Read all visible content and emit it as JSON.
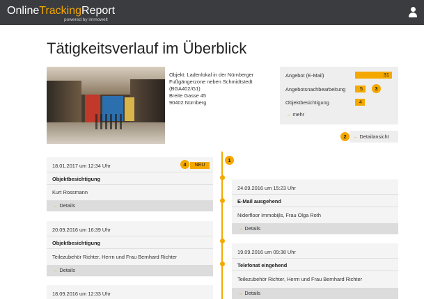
{
  "header": {
    "logo_pre": "Online",
    "logo_accent": "Tracking",
    "logo_post": "Report",
    "logo_sub": "powered by immowelt",
    "user_icon": "user-icon"
  },
  "page": {
    "title": "Tätigkeitsverlauf im Überblick"
  },
  "property": {
    "lines": [
      "Objekt: Ladenlokal in der Nürnberger",
      "Fußgängerzone neben Schmidtstedt",
      "(BGA402/G1)",
      "Breite Gasse 45",
      "90402 Nürnberg"
    ]
  },
  "stats": {
    "items": [
      {
        "label": "Angebot (E-Mail)",
        "value": "31"
      },
      {
        "label": "Angebotsnachbearbeitung",
        "value": "5"
      },
      {
        "label": "Objektbesichtigung",
        "value": "4"
      }
    ],
    "more_label": "mehr",
    "accent_color": "#f5a800"
  },
  "badges": {
    "b1": "1",
    "b2": "2",
    "b3": "3",
    "b4": "4"
  },
  "detail_button": "Detailansicht",
  "timeline": {
    "left": [
      {
        "date": "18.01.2017 um 12:34 Uhr",
        "title": "Objektbesichtigung",
        "person": "Kurt Rossmann",
        "details": "Details",
        "tag": "NEU"
      },
      {
        "date": "20.09.2016 um 16:39 Uhr",
        "title": "Objektbesichtigung",
        "person": "Teilezubehör Richter, Herrn und Frau Bernhard Richter",
        "details": "Details"
      },
      {
        "date": "18.09.2016 um 12:33 Uhr"
      }
    ],
    "right": [
      {
        "date": "24.09.2016 um 15:23 Uhr",
        "title": "E-Mail ausgehend",
        "person": "Niderfloor Immobijls, Frau Olga Roth",
        "details": "Details"
      },
      {
        "date": "19.09.2016 um 09:38 Uhr",
        "title": "Telefonat eingehend",
        "person": "Teilezubehör Richter, Herrn und Frau Bernhard Richter",
        "details": "Details"
      }
    ]
  }
}
